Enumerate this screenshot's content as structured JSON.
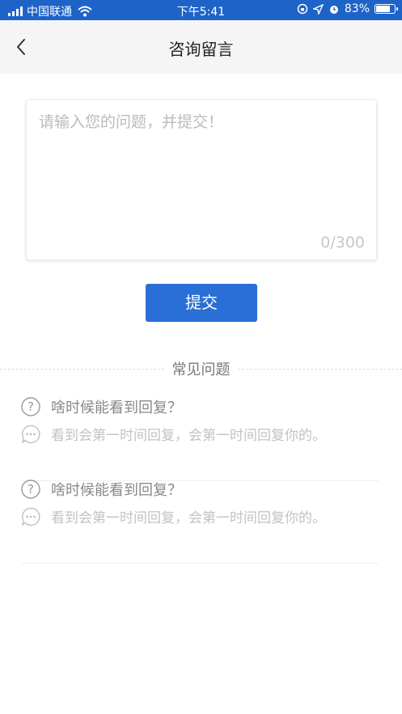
{
  "status_bar": {
    "carrier": "中国联通",
    "time": "下午5:41",
    "battery": "83%",
    "battery_level": 0.83
  },
  "nav": {
    "title": "咨询留言",
    "back_icon": "chevron-left-icon"
  },
  "form": {
    "placeholder": "请输入您的问题，并提交！",
    "counter": "0/300",
    "submit_label": "提交"
  },
  "faq": {
    "heading": "常见问题",
    "items": [
      {
        "question": "啥时候能看到回复？",
        "answer": "看到会第一时间回复，会第一时间回复你的。"
      },
      {
        "question": "啥时候能看到回复？",
        "answer": "看到会第一时间回复，会第一时间回复你的。"
      }
    ]
  },
  "colors": {
    "status_bar": "#1e64c8",
    "accent": "#2a6fd6"
  }
}
